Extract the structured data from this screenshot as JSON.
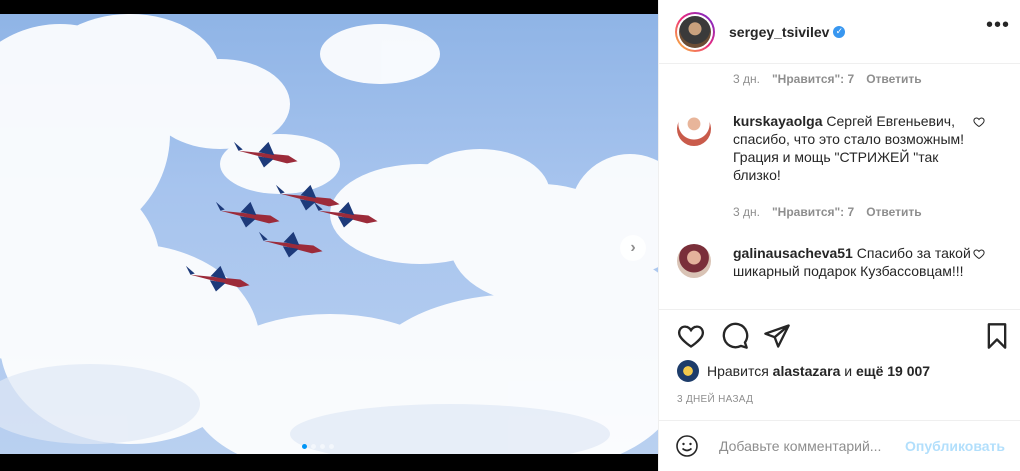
{
  "post": {
    "username": "sergey_tsivilev",
    "verified": true,
    "more_label": "•••"
  },
  "carousel": {
    "dot_count": 4,
    "active_dot": 0
  },
  "comments": [
    {
      "meta": {
        "time": "3 дн.",
        "likes": "\"Нравится\": 7",
        "reply": "Ответить"
      }
    },
    {
      "username": "kurskayaolga",
      "text": "Сергей Евгеньевич, спасибо, что это стало возможным! Грация и мощь \"СТРИЖЕЙ \"так близко!",
      "meta": {
        "time": "3 дн.",
        "likes": "\"Нравится\": 7",
        "reply": "Ответить"
      }
    },
    {
      "username": "galinausacheva51",
      "text": "Спасибо за такой шикарный подарок Кузбассовцам!!!"
    }
  ],
  "likes_line": {
    "prefix": "Нравится",
    "user": "alastazara",
    "middle": "и",
    "rest": "ещё 19 007"
  },
  "time_ago": "3 ДНЕЙ НАЗАД",
  "add_comment": {
    "placeholder": "Добавьте комментарий...",
    "publish": "Опубликовать"
  },
  "icons": {
    "like": "heart-icon",
    "comment": "comment-icon",
    "share": "share-icon",
    "save": "bookmark-icon",
    "emoji": "smiley-icon",
    "next": "chevron-right-icon"
  },
  "colors": {
    "verified": "#3897f0",
    "publish_disabled": "#b2dffc",
    "active_dot": "#0095f6"
  }
}
